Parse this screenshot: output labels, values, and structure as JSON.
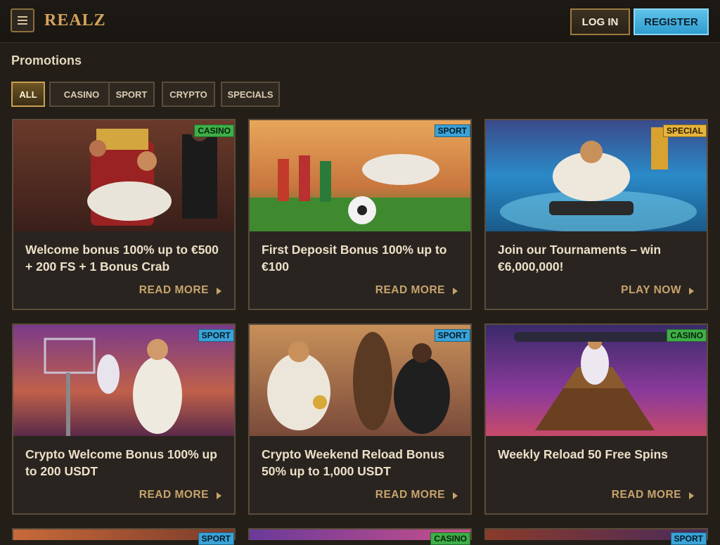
{
  "header": {
    "logo": "REALZ",
    "login_label": "LOG IN",
    "register_label": "REGISTER",
    "menu_icon": "hamburger-icon"
  },
  "page": {
    "title": "Promotions"
  },
  "filters": [
    "ALL",
    "CASINO",
    "SPORT",
    "CRYPTO",
    "SPECIALS"
  ],
  "active_filter": "ALL",
  "promos": [
    {
      "badge": "CASINO",
      "title": "Welcome bonus 100% up to €500 + 200 FS + 1 Bonus Crab",
      "cta": "READ MORE"
    },
    {
      "badge": "SPORT",
      "title": "First Deposit Bonus 100% up to €100",
      "cta": "READ MORE"
    },
    {
      "badge": "SPECIAL",
      "title": "Join our Tournaments – win €6,000,000!",
      "cta": "PLAY NOW"
    },
    {
      "badge": "SPORT",
      "title": "Crypto Welcome Bonus 100% up to 200 USDT",
      "cta": "READ MORE"
    },
    {
      "badge": "SPORT",
      "title": "Crypto Weekend Reload Bonus 50% up to 1,000 USDT",
      "cta": "READ MORE"
    },
    {
      "badge": "CASINO",
      "title": "Weekly Reload 50 Free Spins",
      "cta": "READ MORE"
    },
    {
      "badge": "SPORT",
      "title": "",
      "cta": ""
    },
    {
      "badge": "CASINO",
      "title": "",
      "cta": ""
    },
    {
      "badge": "SPORT",
      "title": "",
      "cta": ""
    }
  ],
  "colors": {
    "background": "#231e18",
    "accent_gold": "#c6a46c",
    "register_blue": "#3aa3d8",
    "badge_casino": "#3fae48",
    "badge_sport": "#3aa3d8",
    "badge_special": "#e7b43c"
  }
}
